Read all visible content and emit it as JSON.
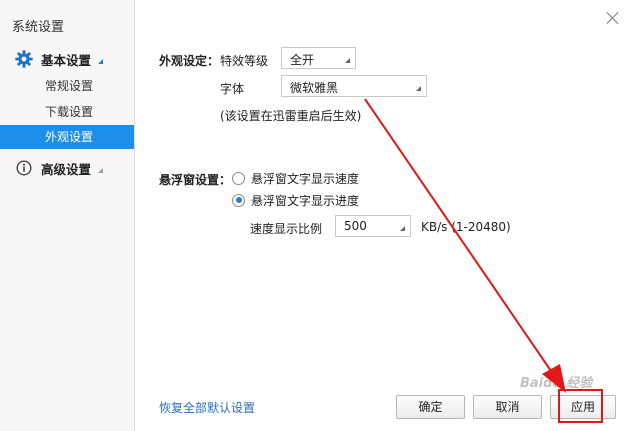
{
  "sidebar": {
    "title": "系统设置",
    "groups": [
      {
        "label": "基本设置",
        "icon": "gear-icon",
        "expanded": true,
        "items": [
          {
            "label": "常规设置"
          },
          {
            "label": "下载设置"
          },
          {
            "label": "外观设置",
            "active": true
          }
        ]
      },
      {
        "label": "高级设置",
        "icon": "info-icon",
        "expanded": false
      }
    ]
  },
  "appearance": {
    "section_label": "外观设定：",
    "effect_label": "特效等级",
    "effect_value": "全开",
    "font_label": "字体",
    "font_value": "微软雅黑",
    "note": "(该设置在迅雷重启后生效)"
  },
  "floating": {
    "section_label": "悬浮窗设置：",
    "option_speed": "悬浮窗文字显示速度",
    "option_progress": "悬浮窗文字显示进度",
    "selected": "progress",
    "ratio_label": "速度显示比例",
    "ratio_value": "500",
    "ratio_unit": "KB/s (1-20480)"
  },
  "footer": {
    "restore_link": "恢复全部默认设置",
    "ok": "确定",
    "cancel": "取消",
    "apply": "应用"
  },
  "watermark": "Baidu 经验",
  "colors": {
    "accent": "#1e8fe8",
    "link": "#2a6ec6",
    "highlight": "#e01818"
  }
}
